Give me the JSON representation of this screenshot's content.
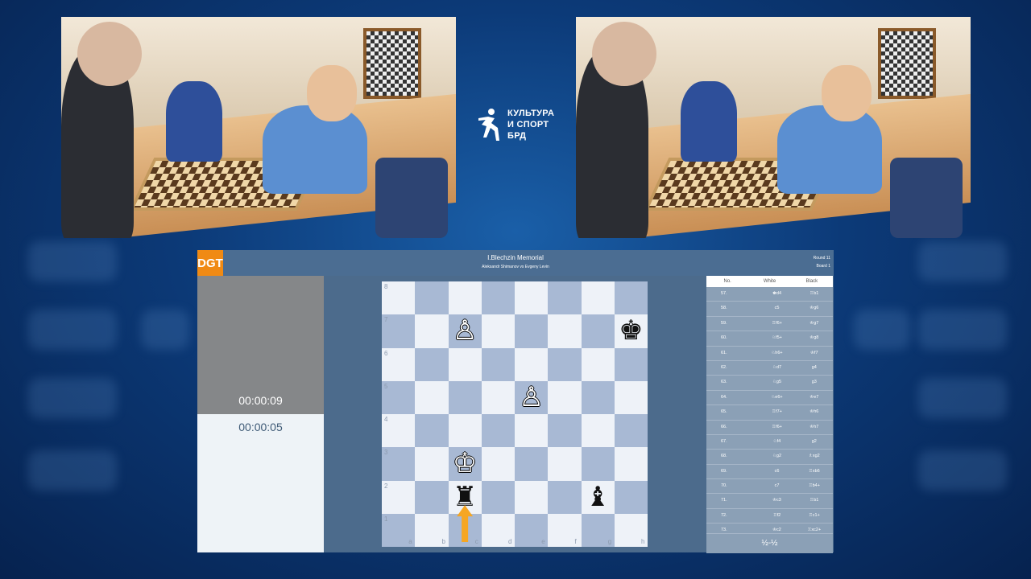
{
  "logo": {
    "icon": "runner-icon",
    "lines": [
      "КУЛЬТУРА",
      "И СПОРТ",
      "БРД"
    ]
  },
  "header": {
    "brand": "DGT",
    "title": "I.Blechzin Memorial",
    "players": "Aleksandr Shimanov vs Evgeny Levin",
    "round": "Round 11",
    "board": "Board 1"
  },
  "clocks": {
    "top": "00:00:09",
    "bottom": "00:00:05"
  },
  "board": {
    "ranks": [
      "8",
      "7",
      "6",
      "5",
      "4",
      "3",
      "2",
      "1"
    ],
    "files": [
      "a",
      "b",
      "c",
      "d",
      "e",
      "f",
      "g",
      "h"
    ],
    "pieces": [
      {
        "square": "c7",
        "glyph": "♙",
        "color": "white",
        "name": "white-pawn-c7"
      },
      {
        "square": "h7",
        "glyph": "♚",
        "color": "black",
        "name": "black-king-h7"
      },
      {
        "square": "e5",
        "glyph": "♙",
        "color": "white",
        "name": "white-pawn-e5"
      },
      {
        "square": "c3",
        "glyph": "♔",
        "color": "white",
        "name": "white-king-c3"
      },
      {
        "square": "c2",
        "glyph": "♜",
        "color": "black",
        "name": "black-rook-c2"
      },
      {
        "square": "g2",
        "glyph": "♝",
        "color": "black",
        "name": "black-bishop-g2"
      }
    ],
    "last_move_arrow": {
      "from": "c1",
      "to": "c2",
      "color": "#f5a623"
    }
  },
  "moves": {
    "headers": [
      "No.",
      "White",
      "Black"
    ],
    "rows": [
      [
        "57.",
        "♚d4",
        "♖b1"
      ],
      [
        "58.",
        "c5",
        "♔g6"
      ],
      [
        "59.",
        "♖f6+",
        "♔g7"
      ],
      [
        "60.",
        "♘f5+",
        "♔g8"
      ],
      [
        "61.",
        "♘h6+",
        "♔f7"
      ],
      [
        "62.",
        "♘d7",
        "g4"
      ],
      [
        "63.",
        "♘g5",
        "g3"
      ],
      [
        "64.",
        "♘e6+",
        "♔e7"
      ],
      [
        "65.",
        "♖f7+",
        "♔h6"
      ],
      [
        "66.",
        "♖f6+",
        "♔h7"
      ],
      [
        "67.",
        "♘f4",
        "g2"
      ],
      [
        "68.",
        "♘g2",
        "♗xg2"
      ],
      [
        "69.",
        "c6",
        "♖xb6"
      ],
      [
        "70.",
        "c7",
        "♖b4+"
      ],
      [
        "71.",
        "♔c3",
        "♖b1"
      ],
      [
        "72.",
        "♖f2",
        "♖c1+"
      ],
      [
        "73.",
        "♔c2",
        "♖xc2+"
      ]
    ],
    "result": "½-½"
  }
}
